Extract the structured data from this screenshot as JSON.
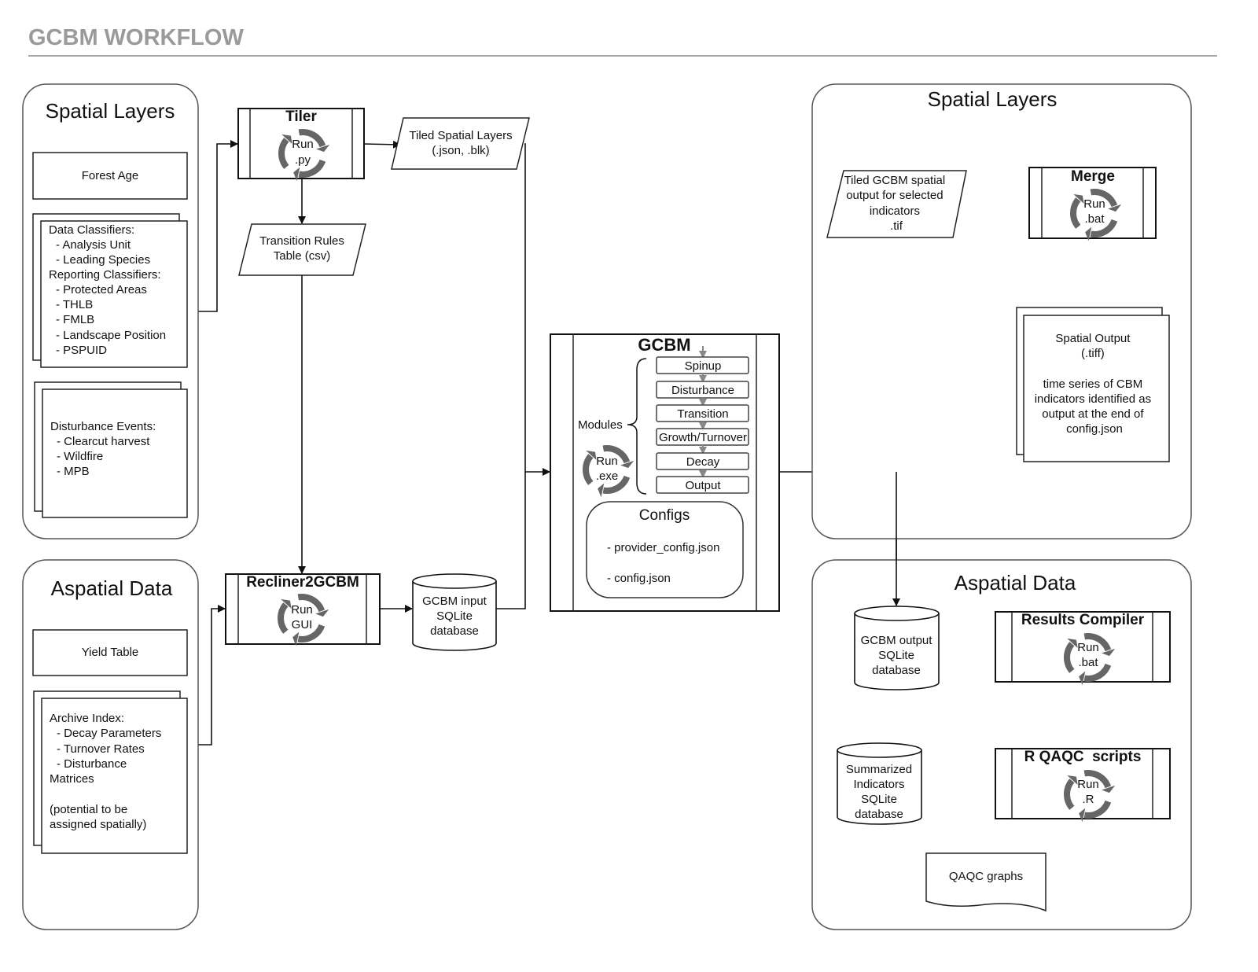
{
  "title": "GCBM WORKFLOW",
  "colors": {
    "title": "#9a9a9a",
    "cycle_icon": "#666666",
    "module_arrow": "#8c8c8c"
  },
  "left_spatial": {
    "title": "Spatial Layers",
    "forest_age": "Forest Age",
    "classifiers": [
      "Data Classifiers:",
      "- Analysis Unit",
      "- Leading Species",
      "Reporting Classifiers:",
      "- Protected Areas",
      "- THLB",
      "- FMLB",
      "- Landscape Position",
      "- PSPUID"
    ],
    "disturbance": [
      "Disturbance Events:",
      "- Clearcut harvest",
      "- Wildfire",
      "- MPB"
    ]
  },
  "left_aspatial": {
    "title": "Aspatial Data",
    "yield": "Yield Table",
    "archive": [
      "Archive Index:",
      "- Decay Parameters",
      "- Turnover Rates",
      "- Disturbance",
      "Matrices",
      "(potential to be",
      "assigned spatially)"
    ]
  },
  "tiler": {
    "title": "Tiler",
    "run": "Run",
    "ext": ".py",
    "icon": "cycle-icon"
  },
  "tiled_layers": [
    "Tiled Spatial Layers",
    "(.json, .blk)"
  ],
  "transition_rules": [
    "Transition Rules",
    "Table (csv)"
  ],
  "recliner": {
    "title": "Recliner2GCBM",
    "run": "Run",
    "ext": "GUI"
  },
  "gcbm_input": [
    "GCBM input",
    "SQLite",
    "database"
  ],
  "gcbm": {
    "title": "GCBM",
    "modules_label": "Modules",
    "modules": [
      "Spinup",
      "Disturbance",
      "Transition",
      "Growth/Turnover",
      "Decay",
      "Output"
    ],
    "run": "Run",
    "ext": ".exe",
    "configs_title": "Configs",
    "configs": [
      "- provider_config.json",
      "- config.json"
    ]
  },
  "right_spatial": {
    "title": "Spatial Layers",
    "tiled_output": [
      "Tiled GCBM spatial",
      "output for selected",
      "indicators",
      ".tif"
    ],
    "merge": {
      "title": "Merge",
      "run": "Run",
      "ext": ".bat"
    },
    "spatial_output": [
      "Spatial Output",
      "(.tiff)",
      "time series of CBM",
      "indicators identified as",
      "output at the end of",
      "config.json"
    ]
  },
  "right_aspatial": {
    "title": "Aspatial Data",
    "gcbm_output": [
      "GCBM output",
      "SQLite",
      "database"
    ],
    "results_compiler": {
      "title": "Results Compiler",
      "run": "Run",
      "ext": ".bat"
    },
    "summarized": [
      "Summarized",
      "Indicators",
      "SQLite",
      "database"
    ],
    "rqaqc": {
      "title": "R QAQC  scripts",
      "run": "Run",
      "ext": ".R"
    },
    "qaqc_graphs": "QAQC graphs"
  }
}
